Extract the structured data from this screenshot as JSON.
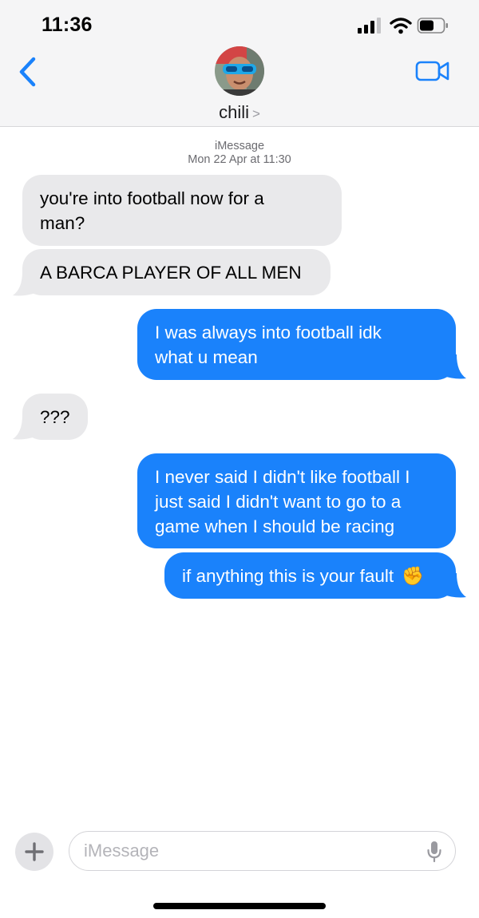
{
  "status_bar": {
    "time": "11:36"
  },
  "header": {
    "contact_name": "chili",
    "contact_chevron": ">",
    "back_icon": "chevron-left-icon",
    "video_icon": "video-camera-icon"
  },
  "conversation": {
    "service": "iMessage",
    "timestamp": "Mon 22 Apr at 11:30",
    "messages": [
      {
        "from": "them",
        "lines": [
          "you're into football now for a",
          "man?"
        ]
      },
      {
        "from": "them",
        "lines": [
          "A BARCA PLAYER OF ALL MEN"
        ]
      },
      {
        "from": "me",
        "lines": [
          "I was always into football idk",
          "what u mean"
        ]
      },
      {
        "from": "them",
        "lines": [
          "???"
        ]
      },
      {
        "from": "me",
        "lines": [
          "I never said I didn't like football I",
          "just said I didn't want to go to a",
          "game when I should be racing"
        ]
      },
      {
        "from": "me",
        "lines": [
          "if anything this is your fault"
        ],
        "emoji": "✊"
      }
    ]
  },
  "composer": {
    "placeholder": "iMessage",
    "plus_label": "+"
  },
  "colors": {
    "outgoing": "#1a82fb",
    "incoming": "#e9e9eb",
    "accent": "#1a82fb"
  }
}
